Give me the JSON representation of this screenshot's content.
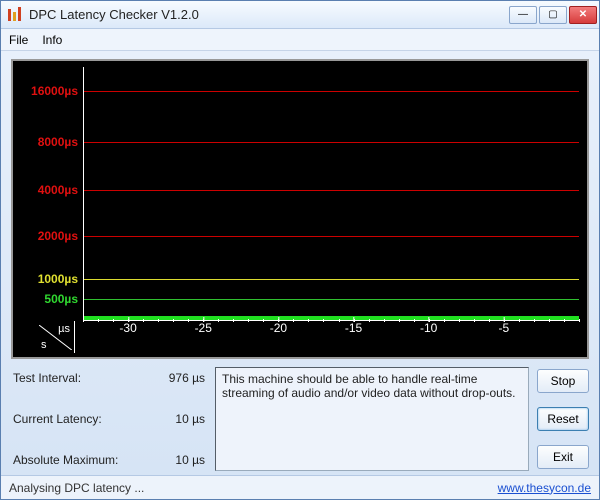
{
  "window": {
    "title": "DPC Latency Checker V1.2.0"
  },
  "menu": {
    "file": "File",
    "info": "Info"
  },
  "chart_data": {
    "type": "bar",
    "title": "",
    "xlabel": "s",
    "ylabel": "µs",
    "y_gridlines": [
      {
        "value": 500,
        "label": "500µs",
        "class": "green"
      },
      {
        "value": 1000,
        "label": "1000µs",
        "class": "yellow"
      },
      {
        "value": 2000,
        "label": "2000µs",
        "class": "red"
      },
      {
        "value": 4000,
        "label": "4000µs",
        "class": "red"
      },
      {
        "value": 8000,
        "label": "8000µs",
        "class": "red"
      },
      {
        "value": 16000,
        "label": "16000µs",
        "class": "red"
      }
    ],
    "x_ticks": [
      -30,
      -25,
      -20,
      -15,
      -10,
      -5
    ],
    "ylim": [
      0,
      16000
    ],
    "xlim": [
      -33,
      0
    ],
    "data_summary": "all bars approx 10µs (green) across visible window"
  },
  "axis_corner": {
    "mu": "µs",
    "sec": "s"
  },
  "stats": {
    "test_interval_label": "Test Interval:",
    "test_interval_value": "976 µs",
    "current_latency_label": "Current Latency:",
    "current_latency_value": "10 µs",
    "absolute_max_label": "Absolute Maximum:",
    "absolute_max_value": "10 µs"
  },
  "message": "This machine should be able to handle real-time streaming of audio and/or video data without drop-outs.",
  "buttons": {
    "stop": "Stop",
    "reset": "Reset",
    "exit": "Exit"
  },
  "status": {
    "text": "Analysing DPC latency ...",
    "link": "www.thesycon.de"
  }
}
